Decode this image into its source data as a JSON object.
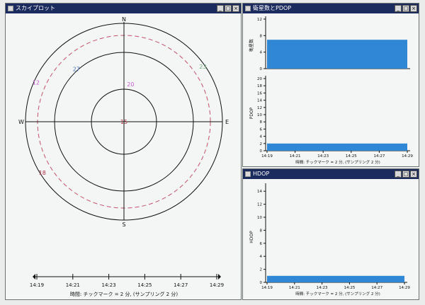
{
  "skyplot": {
    "title": "スカイプロット",
    "controls": [
      "_",
      "□",
      "×"
    ],
    "compass": {
      "north": "N",
      "south": "S",
      "east": "E",
      "west": "W"
    },
    "satellites": [
      {
        "id": "15",
        "azimuth": 270,
        "elevation": 90,
        "color": "#b03045"
      },
      {
        "id": "20",
        "azimuth": 10,
        "elevation": 55,
        "color": "#c65ad0"
      },
      {
        "id": "23",
        "azimuth": 55,
        "elevation": 2,
        "color": "#6fa879"
      },
      {
        "id": "27",
        "azimuth": 318,
        "elevation": 25,
        "color": "#4a75bd"
      },
      {
        "id": "12",
        "azimuth": 294,
        "elevation": 2,
        "color": "#c65ad0"
      },
      {
        "id": "18",
        "azimuth": 238,
        "elevation": 2,
        "color": "#b03045"
      }
    ],
    "time_axis": {
      "ticks": [
        "14:19",
        "14:21",
        "14:23",
        "14:25",
        "14:27",
        "14:29"
      ],
      "caption": "時間: チックマーク = 2 分, (サンプリング 2 分)"
    }
  },
  "satcount_pdop": {
    "title": "衛星数とPDOP",
    "controls": [
      "_",
      "□",
      "×"
    ],
    "satcount": {
      "ylabel": "衛星数",
      "y_ticks": [
        "12",
        "8",
        "4",
        "0"
      ],
      "level": 7,
      "ymax": 12
    },
    "pdop": {
      "ylabel": "PDOP",
      "y_ticks": [
        "20",
        "18",
        "16",
        "14",
        "12",
        "10",
        "8",
        "6",
        "4",
        "2",
        "0"
      ],
      "level": 2,
      "ymax": 20
    },
    "x_ticks": [
      "14:19",
      "14:21",
      "14:23",
      "14:25",
      "14:27",
      "14:29"
    ],
    "caption": "時間: チックマーク = 2 分, (サンプリング 2 分)"
  },
  "hdop": {
    "title": "HDOP",
    "controls": [
      "_",
      "□",
      "×"
    ],
    "ylabel": "HDOP",
    "y_ticks": [
      "14",
      "12",
      "10",
      "8",
      "6",
      "4",
      "2",
      "0"
    ],
    "level": 1,
    "ymax": 15,
    "x_ticks": [
      "14:19",
      "14:21",
      "14:23",
      "14:25",
      "14:27",
      "14:29"
    ],
    "caption": "時間: チックマーク = 2 分, (サンプリング 2 分)"
  }
}
